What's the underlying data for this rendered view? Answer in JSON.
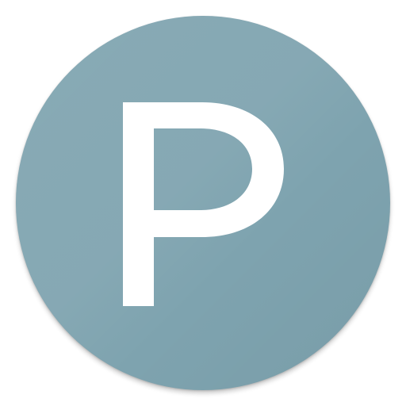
{
  "icon": {
    "name": "parking-app-icon",
    "letter": "P",
    "background_color": "#7ea3af",
    "glyph_color": "#ffffff"
  }
}
